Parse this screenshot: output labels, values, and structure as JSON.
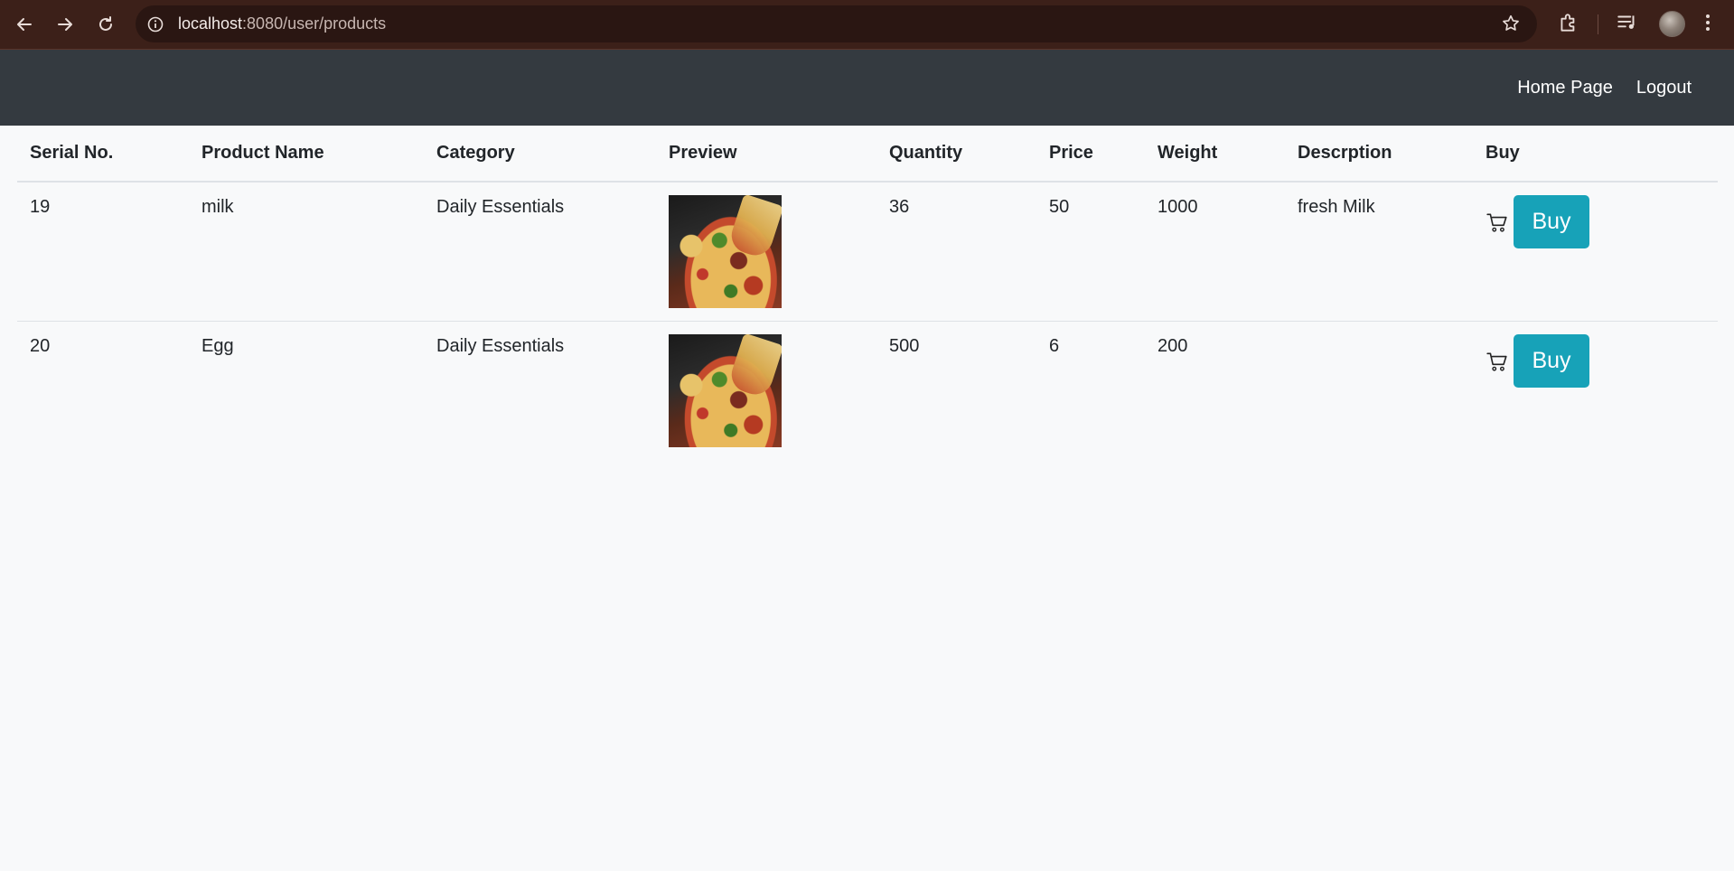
{
  "browser": {
    "url_host": "localhost",
    "url_rest": ":8080/user/products"
  },
  "navbar": {
    "links": [
      "Home Page",
      "Logout"
    ]
  },
  "table": {
    "headers": [
      "Serial No.",
      "Product Name",
      "Category",
      "Preview",
      "Quantity",
      "Price",
      "Weight",
      "Descrption",
      "Buy"
    ],
    "rows": [
      {
        "serial": "19",
        "name": "milk",
        "category": "Daily Essentials",
        "quantity": "36",
        "price": "50",
        "weight": "1000",
        "description": "fresh Milk",
        "buy_label": "Buy"
      },
      {
        "serial": "20",
        "name": "Egg",
        "category": "Daily Essentials",
        "quantity": "500",
        "price": "6",
        "weight": "200",
        "description": "",
        "buy_label": "Buy"
      }
    ]
  },
  "icons": {
    "back": "back-arrow-icon",
    "forward": "forward-arrow-icon",
    "reload": "reload-icon",
    "site_info": "info-icon",
    "bookmark": "star-icon",
    "extensions": "puzzle-icon",
    "media": "media-control-icon",
    "menu": "kebab-menu-icon",
    "cart": "cart-icon"
  },
  "colors": {
    "browser_bar": "#3c2019",
    "navbar": "#343a40",
    "page_bg": "#f8f9fa",
    "buy_button": "#17a2b8"
  }
}
